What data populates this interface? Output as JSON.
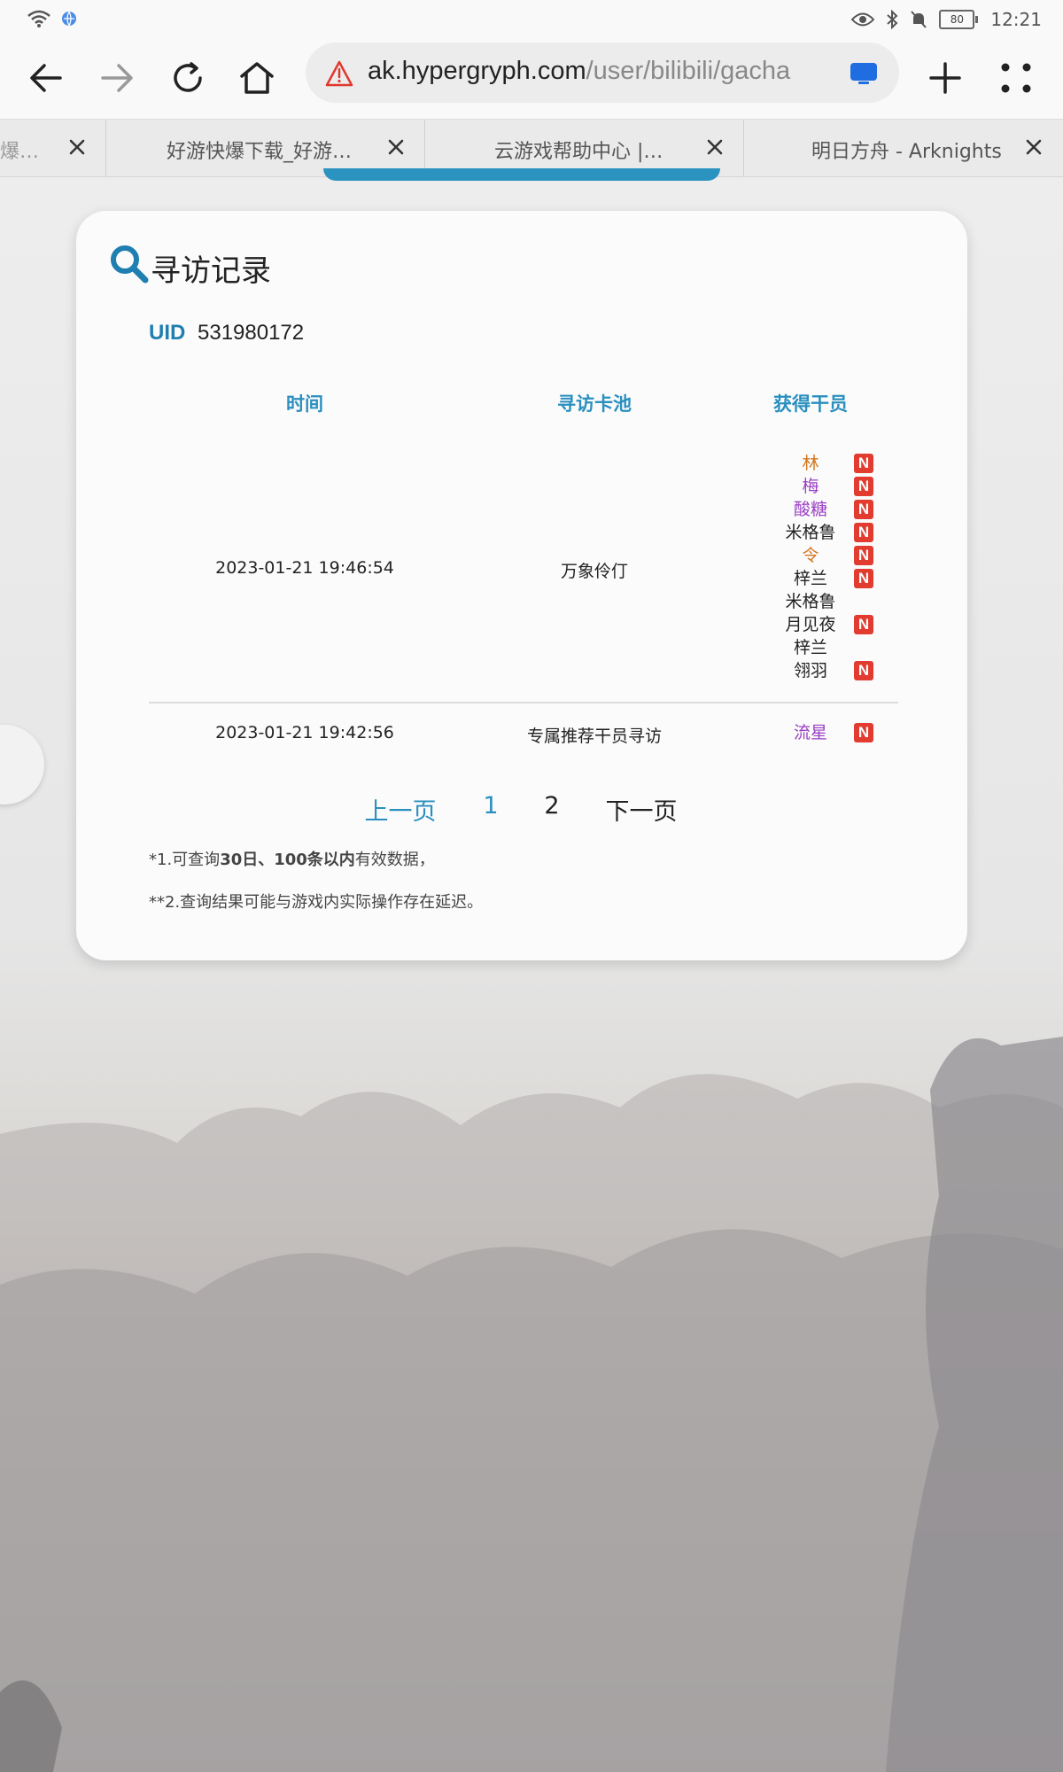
{
  "status_bar": {
    "time": "12:21",
    "battery": "80"
  },
  "toolbar": {
    "url_domain": "ak.hypergryph.com",
    "url_path": "/user/bilibili/gacha"
  },
  "tabs": [
    {
      "title": "爆…"
    },
    {
      "title": "好游快爆下载_好游…"
    },
    {
      "title": "云游戏帮助中心 |…"
    },
    {
      "title": "明日方舟 - Arknights"
    }
  ],
  "card": {
    "title": "寻访记录",
    "uid_label": "UID",
    "uid_value": "531980172",
    "columns": [
      "时间",
      "寻访卡池",
      "获得干员"
    ],
    "rows": [
      {
        "time": "2023-01-21 19:46:54",
        "pool": "万象伶仃",
        "operators": [
          {
            "name": "林",
            "new": "N",
            "rarity_color": "#d2761f"
          },
          {
            "name": "梅",
            "new": "N",
            "rarity_color": "#9a3fc4"
          },
          {
            "name": "酸糖",
            "new": "N",
            "rarity_color": "#9a3fc4"
          },
          {
            "name": "米格鲁",
            "new": "N",
            "rarity_color": "#222222"
          },
          {
            "name": "令",
            "new": "N",
            "rarity_color": "#d2761f"
          },
          {
            "name": "梓兰",
            "new": "N",
            "rarity_color": "#222222"
          },
          {
            "name": "米格鲁",
            "new": "",
            "rarity_color": "#222222"
          },
          {
            "name": "月见夜",
            "new": "N",
            "rarity_color": "#222222"
          },
          {
            "name": "梓兰",
            "new": "",
            "rarity_color": "#222222"
          },
          {
            "name": "翎羽",
            "new": "N",
            "rarity_color": "#222222"
          }
        ]
      },
      {
        "time": "2023-01-21 19:42:56",
        "pool": "专属推荐干员寻访",
        "operators": [
          {
            "name": "流星",
            "new": "N",
            "rarity_color": "#9a3fc4"
          }
        ]
      }
    ],
    "pagination": {
      "prev": "上一页",
      "pages": [
        "1",
        "2"
      ],
      "next": "下一页"
    },
    "notes": {
      "n1_a": "*1.可查询",
      "n1_b": "30日、100条以内",
      "n1_c": "有效数据，",
      "n2": "**2.查询结果可能与游戏内实际操作存在延迟。"
    }
  },
  "colors": {
    "accent": "#2a8fbf",
    "badge": "#e23b30",
    "six_star": "#d2761f",
    "five_star": "#9a3fc4"
  }
}
